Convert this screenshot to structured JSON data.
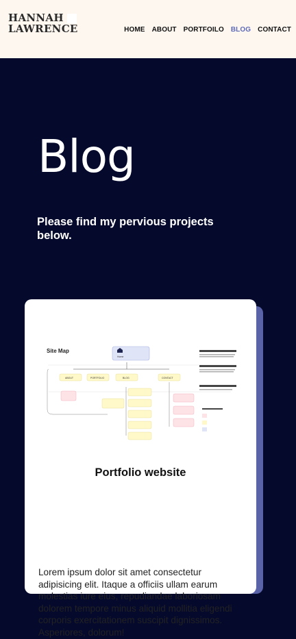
{
  "header": {
    "logo_line1": "HANNAH",
    "logo_line2": "LAWRENCE",
    "nav": [
      {
        "label": "HOME",
        "active": false
      },
      {
        "label": "ABOUT",
        "active": false
      },
      {
        "label": "PORTFOILO",
        "active": false
      },
      {
        "label": "BLOG",
        "active": true
      },
      {
        "label": "CONTACT",
        "active": false
      }
    ]
  },
  "main": {
    "title": "Blog",
    "subtitle": "Please find my pervious projects below."
  },
  "card": {
    "image": {
      "title": "Site Map",
      "top_box": "Home",
      "pages": [
        "ABOUT",
        "PORTFOLIO",
        "BLOG",
        "CONTACT"
      ]
    },
    "title": "Portfolio website",
    "body": "Lorem ipsum dolor sit amet consectetur adipisicing elit. Itaque a officiis ullam earum molestias iure eius, repudiandae laboriosam dolorem tempore minus aliquid mollitia eligendi corporis exercitationem suscipit dignissimos. Asperiores, dolorum!"
  },
  "colors": {
    "header_bg": "#fdf7ef",
    "hero_bg": "#050a2d",
    "accent": "#5f6bb7",
    "card_shadow": "#5a62a8"
  }
}
